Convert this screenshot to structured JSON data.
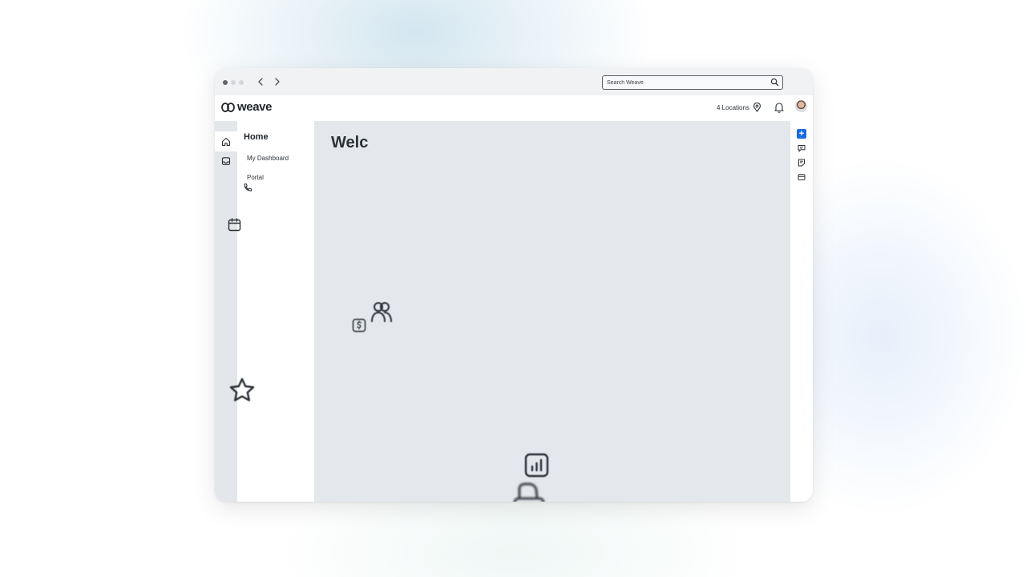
{
  "browser": {
    "back_icon": "chevron-left-icon",
    "forward_icon": "chevron-right-icon",
    "search": {
      "placeholder": "Search Weave",
      "icon": "search-icon"
    }
  },
  "header": {
    "logo_text": "weave",
    "locations_label": "4 Locations",
    "location_icon": "map-pin-icon",
    "notifications_icon": "bell-icon",
    "avatar": "user-avatar"
  },
  "rail": {
    "items": [
      {
        "icon": "home-icon",
        "active": true
      },
      {
        "icon": "inbox-icon",
        "active": false
      }
    ]
  },
  "sidebar": {
    "title": "Home",
    "items": [
      {
        "label": "My Dashboard"
      },
      {
        "label": "Portal"
      }
    ]
  },
  "main": {
    "heading": "Welc"
  },
  "right_rail": {
    "items": [
      {
        "icon": "plus-icon",
        "label": "+"
      },
      {
        "icon": "message-icon"
      },
      {
        "icon": "note-icon"
      },
      {
        "icon": "card-icon"
      }
    ]
  },
  "floating_icons": [
    "phone-icon",
    "calendar-icon",
    "dollar-tag-icon",
    "users-icon",
    "star-icon",
    "bar-chart-icon",
    "payment-terminal-icon"
  ],
  "colors": {
    "accent": "#1a6be0",
    "main_bg": "#e4e7eb",
    "rail_bg": "#e3e6ea"
  }
}
